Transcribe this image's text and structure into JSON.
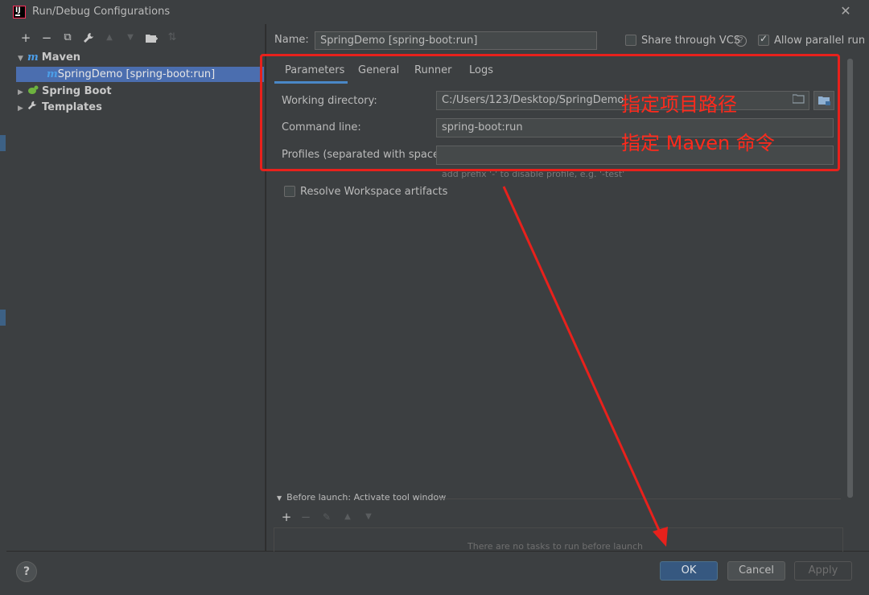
{
  "window": {
    "title": "Run/Debug Configurations"
  },
  "toolbar": {
    "add": "+",
    "remove": "−",
    "copy": "⧉",
    "edit": "🔧",
    "up": "▲",
    "down": "▼",
    "folder": "📁",
    "sort": "⇅"
  },
  "tree": {
    "maven": "Maven",
    "selected_config": "SpringDemo [spring-boot:run]",
    "spring_boot": "Spring Boot",
    "templates": "Templates"
  },
  "name": {
    "label": "Name:",
    "value": "SpringDemo [spring-boot:run]"
  },
  "options": {
    "share_vcs": "Share through VCS",
    "allow_parallel": "Allow parallel run"
  },
  "tabs": [
    "Parameters",
    "General",
    "Runner",
    "Logs"
  ],
  "fields": {
    "working_dir_label": "Working directory:",
    "working_dir_value": "C:/Users/123/Desktop/SpringDemo",
    "command_line_label": "Command line:",
    "command_line_value": "spring-boot:run",
    "profiles_label": "Profiles (separated with space):",
    "profiles_value": "",
    "profiles_hint": "add prefix '-' to disable profile, e.g. '-test'"
  },
  "resolve_workspace": "Resolve Workspace artifacts",
  "annotations": {
    "project_path": "指定项目路径",
    "maven_command": "指定 Maven 命令"
  },
  "before_launch": {
    "title": "Before launch: Activate tool window",
    "empty": "There are no tasks to run before launch"
  },
  "buttons": {
    "help": "?",
    "ok": "OK",
    "cancel": "Cancel",
    "apply": "Apply"
  },
  "colors": {
    "accent": "#4a88c7",
    "selection": "#4b6eaf",
    "annotation": "#e8211c",
    "primary_button": "#365880"
  }
}
